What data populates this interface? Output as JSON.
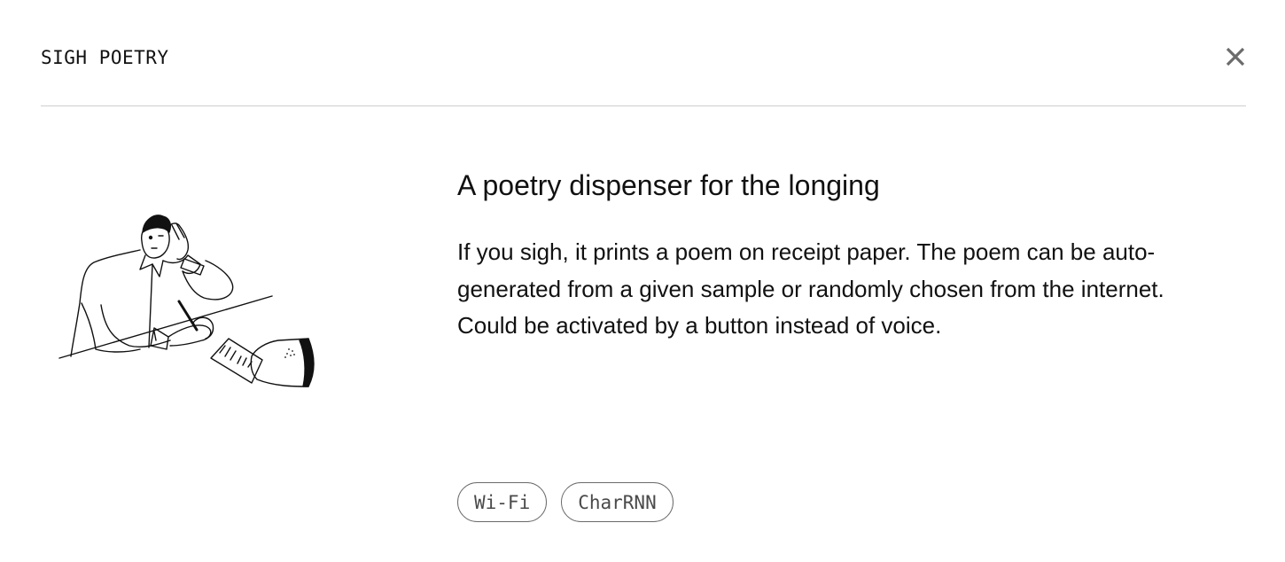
{
  "header": {
    "title": "SIGH POETRY",
    "close_icon": "close-icon"
  },
  "illustration": {
    "icon": "person-sighing-receipt-printer-illustration"
  },
  "main": {
    "headline": "A poetry dispenser for the longing",
    "description": "If you sigh, it prints a poem on receipt paper. The poem can be auto-generated from a given sample or randomly chosen from the internet. Could be activated by a button instead of voice."
  },
  "tags": [
    {
      "label": "Wi-Fi"
    },
    {
      "label": "CharRNN"
    }
  ],
  "colors": {
    "text": "#111111",
    "divider": "#cfcfcf",
    "tag_border": "#6a6a6a",
    "tag_text": "#4a4a4a",
    "close_icon": "#6b6b6b"
  }
}
